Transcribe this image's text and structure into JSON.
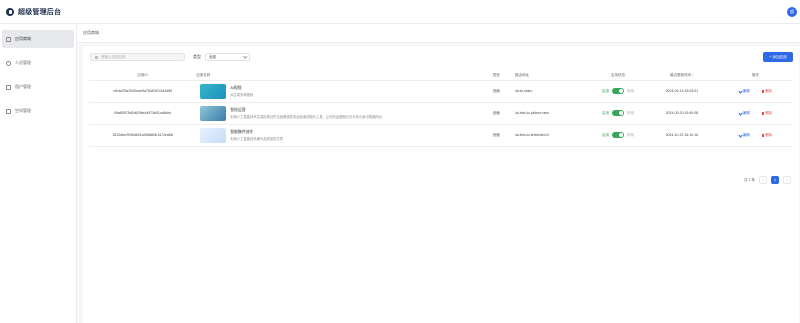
{
  "app": {
    "title": "超级管理后台",
    "avatar_text": "超"
  },
  "sidebar": {
    "items": [
      {
        "label": "应用商城",
        "icon": "grid-icon",
        "active": true
      },
      {
        "label": "人员管理",
        "icon": "user-icon",
        "active": false
      },
      {
        "label": "租户管理",
        "icon": "tenant-icon",
        "active": false
      },
      {
        "label": "空间管理",
        "icon": "space-icon",
        "active": false
      }
    ]
  },
  "tabbar": {
    "active_tab": "应用商城"
  },
  "toolbar": {
    "search_placeholder": "请输入应用名称",
    "type_label": "类型",
    "type_value": "全部",
    "add_button": "+ 添加应用"
  },
  "table": {
    "headers": {
      "id": "应用ID",
      "name": "应用名称",
      "type": "类型",
      "route": "路由地址",
      "status": "应用状态",
      "time": "最近更新时间",
      "actions": "操作"
    },
    "rows": [
      {
        "id": "c5cbd78a7b40eae5a78453f7c2d4d89",
        "name": "AI视频",
        "desc": "AI生成多种视频",
        "type": "页面",
        "route": "/ai-to-video",
        "status_on": "启用",
        "status_off": "停用",
        "time": "2024-09-14 19:03:01",
        "edit": "编辑",
        "delete": "删除"
      },
      {
        "id": "49a80578d2d929fe4d973b01ca8cbb",
        "name": "智绘运营",
        "desc": "利用人工智能技术生成精美且符合品牌调性的运营素材图片工具，让你的运营图片在众多元素中脱颖而出",
        "type": "页面",
        "route": "/ai-text-to-picture-new",
        "status_on": "启用",
        "status_off": "停用",
        "time": "2024-09-20 19:40:08",
        "edit": "编辑",
        "delete": "删除"
      },
      {
        "id": "3232dbe293bdb01a9468d0b1d72ea68",
        "name": "智能稿件创作",
        "desc": "利用人工智能技术编写高质量的文章",
        "type": "页面",
        "route": "/ai-text-to-text/index/4",
        "status_on": "启用",
        "status_off": "停用",
        "time": "2024-10-22 16:10:16",
        "edit": "编辑",
        "delete": "删除"
      }
    ]
  },
  "pagination": {
    "total_text": "共 3 条",
    "prev": "‹",
    "current": "1",
    "next": "›"
  },
  "colors": {
    "primary": "#2f6ae6",
    "success": "#3aa55d",
    "danger": "#e24d4d",
    "title": "#1f2f4f"
  }
}
